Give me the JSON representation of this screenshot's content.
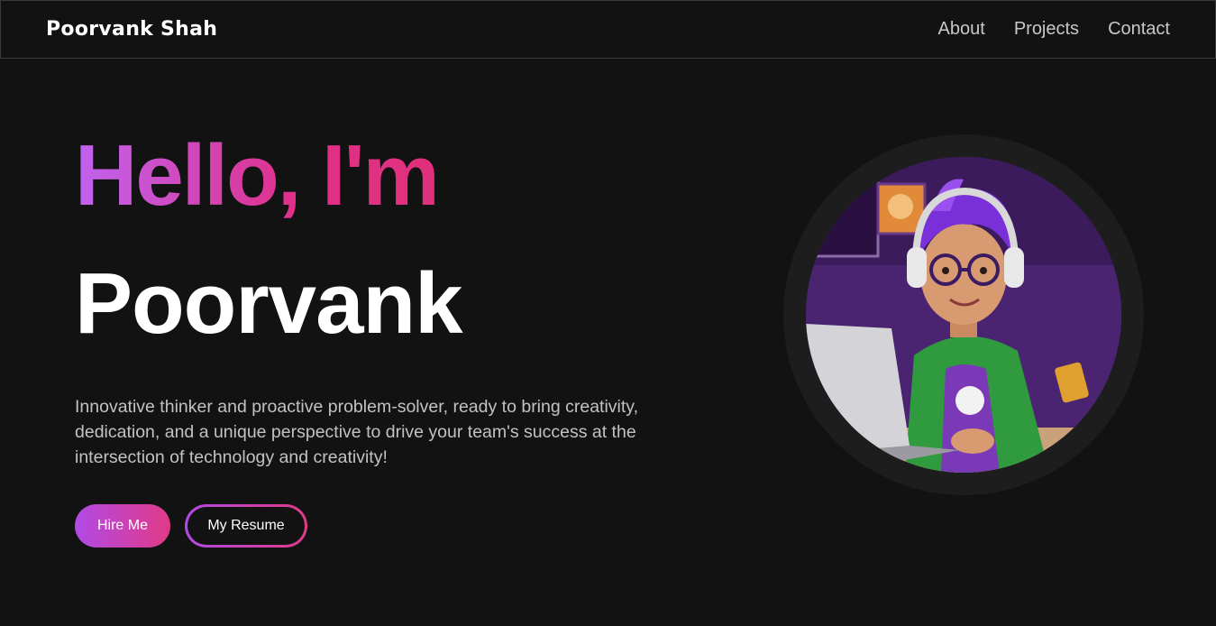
{
  "nav": {
    "brand": "Poorvank Shah",
    "links": [
      "About",
      "Projects",
      "Contact"
    ]
  },
  "hero": {
    "greeting": "Hello, I'm",
    "name": "Poorvank",
    "tagline": "Innovative thinker and proactive problem-solver, ready to bring creativity, dedication, and a unique perspective to drive your team's success at the intersection of technology and creativity!",
    "hire_label": "Hire Me",
    "resume_label": "My Resume"
  },
  "colors": {
    "background": "#121212",
    "gradient_start": "#b14ae6",
    "gradient_end": "#e03a86",
    "ring": "#1d1d1d"
  },
  "avatar": {
    "description_icon": "avatar-illustration"
  }
}
